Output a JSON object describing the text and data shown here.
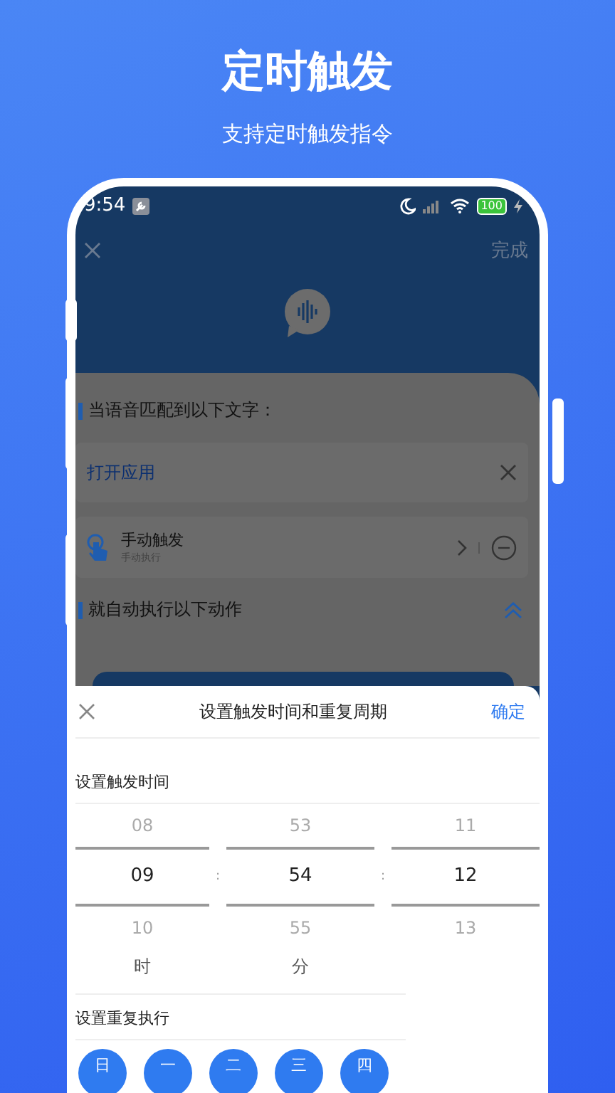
{
  "promo": {
    "title": "定时触发",
    "subtitle": "支持定时触发指令"
  },
  "status_bar": {
    "time": "9:54",
    "battery": "100"
  },
  "top_bar": {
    "done": "完成"
  },
  "trigger_section": {
    "heading": "当语音匹配到以下文字：",
    "phrase": "打开应用",
    "trigger": {
      "title": "手动触发",
      "subtitle": "手动执行"
    }
  },
  "action_section": {
    "heading": "就自动执行以下动作"
  },
  "sheet": {
    "title": "设置触发时间和重复周期",
    "confirm": "确定",
    "time_label": "设置触发时间",
    "columns": [
      {
        "above": "08",
        "value": "09",
        "below": "10",
        "unit": "时"
      },
      {
        "above": "53",
        "value": "54",
        "below": "55",
        "unit": "分"
      },
      {
        "above": "11",
        "value": "12",
        "below": "13"
      }
    ],
    "separator": ":",
    "repeat_label": "设置重复执行",
    "weekdays": [
      "日",
      "一",
      "二",
      "三",
      "四"
    ]
  }
}
